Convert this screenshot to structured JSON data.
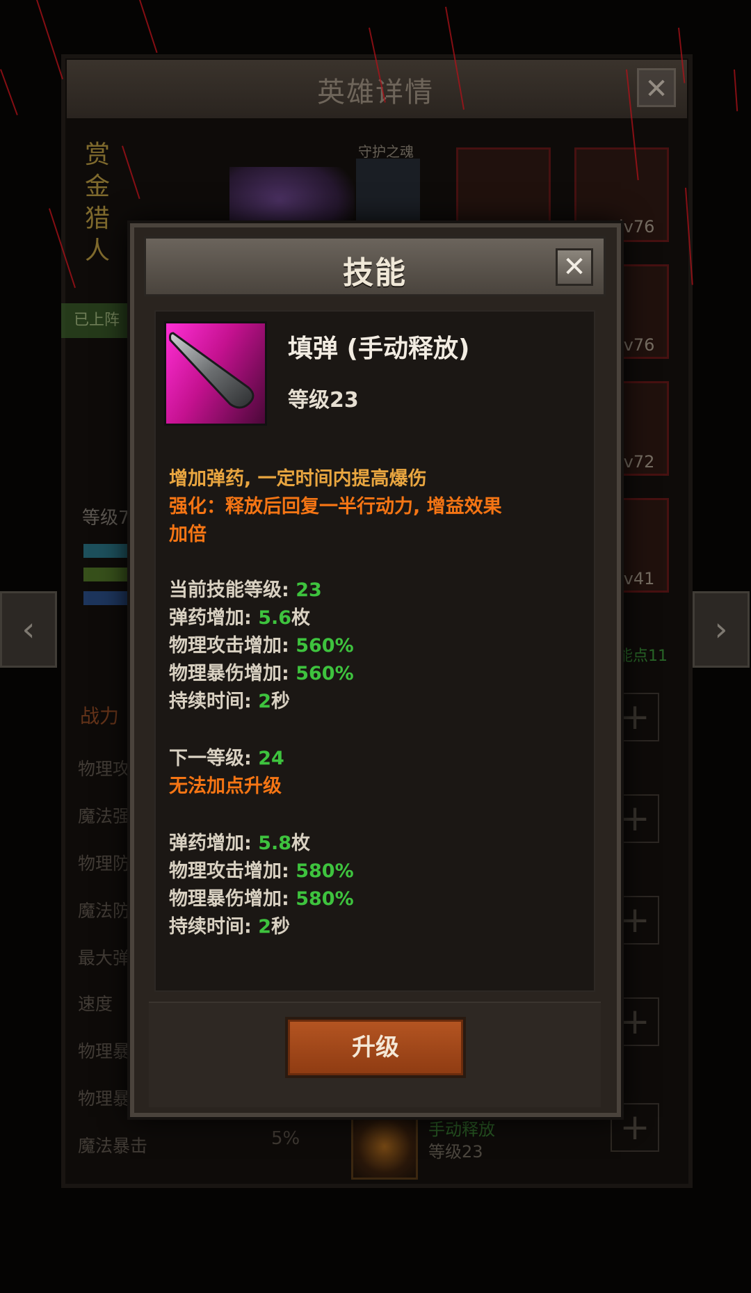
{
  "background": {
    "window_title": "英雄详情",
    "close_label": "✕",
    "hero_name": "赏金猎人",
    "soul_label": "守护之魂",
    "deployed_label": "已上阵",
    "equipment_levels": [
      "lv76",
      "lv76",
      "lv72",
      "lv41"
    ],
    "level_label": "等级7",
    "prev_arrow": "‹",
    "next_arrow": "›",
    "skill_points_label": "能点11",
    "power_label": "战力",
    "stats": [
      "物理攻",
      "魔法强",
      "物理防",
      "魔法防",
      "最大弹",
      "速度",
      "物理暴",
      "物理暴",
      "魔法暴击"
    ],
    "magic_crit_value": "5%",
    "plus_symbol": "+",
    "skill_row": {
      "name": "手动释放",
      "level": "等级23"
    }
  },
  "dialog": {
    "title": "技能",
    "close_label": "✕",
    "icon": "bullet-icon",
    "skill_name": "填弹 (手动释放)",
    "skill_level": "等级23",
    "description": "增加弹药, 一定时间内提高爆伤",
    "enhance_line1": "强化：释放后回复一半行动力, 增益效果",
    "enhance_line2": "加倍",
    "current": {
      "skill_level_label": "当前技能等级: ",
      "skill_level_value": "23",
      "ammo_label": "弹药增加: ",
      "ammo_value": "5.6",
      "ammo_unit": "枚",
      "atk_label": "物理攻击增加: ",
      "atk_value": "560%",
      "crit_label": "物理暴伤增加: ",
      "crit_value": "560%",
      "duration_label": "持续时间: ",
      "duration_value": "2",
      "duration_unit": "秒"
    },
    "next": {
      "level_label": "下一等级: ",
      "level_value": "24",
      "warning": "无法加点升级",
      "ammo_label": "弹药增加: ",
      "ammo_value": "5.8",
      "ammo_unit": "枚",
      "atk_label": "物理攻击增加: ",
      "atk_value": "580%",
      "crit_label": "物理暴伤增加: ",
      "crit_value": "580%",
      "duration_label": "持续时间: ",
      "duration_value": "2",
      "duration_unit": "秒"
    },
    "upgrade_button": "升级"
  },
  "colors": {
    "accent_gold": "#e9a640",
    "accent_orange": "#f57514",
    "value_green": "#3ec33e",
    "button_orange": "#b55522"
  }
}
